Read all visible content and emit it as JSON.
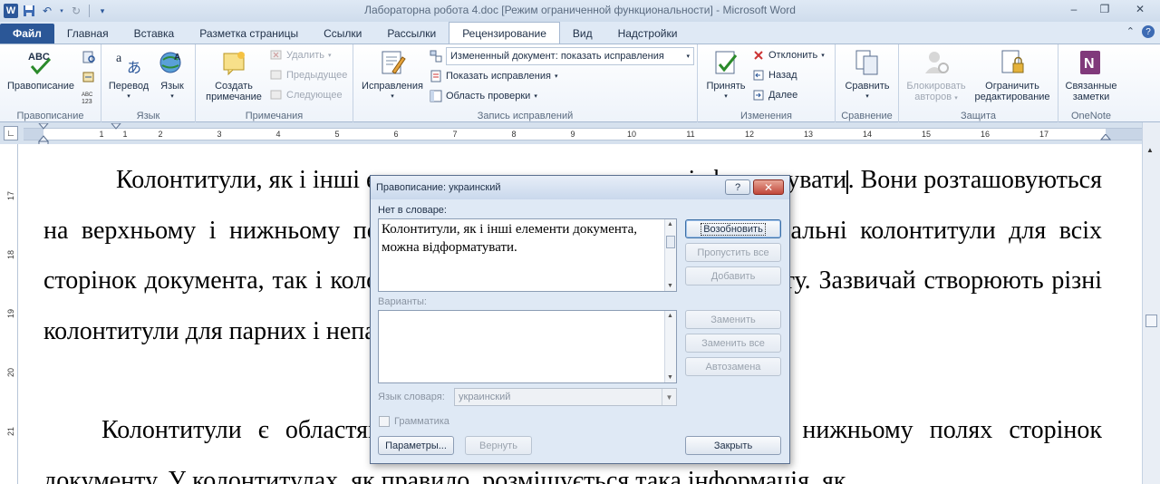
{
  "window": {
    "title": "Лабораторна робота 4.doc [Режим ограниченной функциональности]  -  Microsoft Word"
  },
  "tabs": [
    {
      "label": "Файл"
    },
    {
      "label": "Главная"
    },
    {
      "label": "Вставка"
    },
    {
      "label": "Разметка страницы"
    },
    {
      "label": "Ссылки"
    },
    {
      "label": "Рассылки"
    },
    {
      "label": "Рецензирование"
    },
    {
      "label": "Вид"
    },
    {
      "label": "Надстройки"
    }
  ],
  "ribbon": {
    "spelling": {
      "btn": "Правописание",
      "group": "Правописание"
    },
    "language": {
      "translate": "Перевод",
      "language": "Язык",
      "group": "Язык"
    },
    "comments": {
      "create": "Создать примечание",
      "create_l1": "Создать",
      "create_l2": "примечание",
      "delete": "Удалить",
      "prev": "Предыдущее",
      "next": "Следующее",
      "group": "Примечания"
    },
    "tracking": {
      "track": "Исправления",
      "display_combo": "Измененный документ: показать исправления",
      "show_markup": "Показать исправления",
      "review_pane": "Область проверки",
      "group": "Запись исправлений"
    },
    "changes": {
      "accept": "Принять",
      "reject": "Отклонить",
      "back": "Назад",
      "next": "Далее",
      "group": "Изменения"
    },
    "compare": {
      "btn": "Сравнить",
      "group": "Сравнение"
    },
    "protect": {
      "block_l1": "Блокировать",
      "block_l2": "авторов",
      "restrict_l1": "Ограничить",
      "restrict_l2": "редактирование",
      "group": "Защита"
    },
    "onenote": {
      "linked_l1": "Связанные",
      "linked_l2": "заметки",
      "group": "OneNote"
    }
  },
  "ruler": {
    "h_numbers": [
      "1",
      "1",
      "2",
      "3",
      "4",
      "5",
      "6",
      "7",
      "8",
      "9",
      "10",
      "11",
      "12",
      "13",
      "14",
      "15",
      "16",
      "17"
    ],
    "v_numbers": [
      "17",
      "18",
      "19",
      "20",
      "21"
    ]
  },
  "document": {
    "p1_before_cursor": "Колонтитули, як і інші елементи документа, можна відформатувати",
    "p1_after_cursor": ". Вони розташовуються на верхньому і нижньому полях сторінки. Word допускає як загальні колонтитули для всіх сторінок документа, так і колонтитули для кожного фрагмента тексту. Зазвичай створюють різні колонтитули для парних і непарних сторінок.",
    "p2": "Колонтитули є областями, розташованими на верхньому і нижньому полях сторінок документу. У колонтитулах, як правило, розміщується така інформація, як"
  },
  "dialog": {
    "title": "Правописание: украинский",
    "help_label": "?",
    "close_label": "✕",
    "not_in_dict_label": "Нет в словаре:",
    "not_in_dict_text": "Колонтитули, як і інші елементи документа, можна відформатувати.",
    "suggestions_label": "Варианты:",
    "dict_lang_label": "Язык словаря:",
    "dict_lang_value": "украинский",
    "grammar_label": "Грамматика",
    "buttons": {
      "resume": "Возобновить",
      "skip_all": "Пропустить все",
      "add": "Добавить",
      "change": "Заменить",
      "change_all": "Заменить все",
      "autocorrect": "Автозамена",
      "options": "Параметры...",
      "undo": "Вернуть",
      "close": "Закрыть"
    }
  },
  "colors": {
    "accent": "#2b5797",
    "ribbon_bg": "#eef3fa",
    "dialog_bg": "#dfe9f5"
  }
}
